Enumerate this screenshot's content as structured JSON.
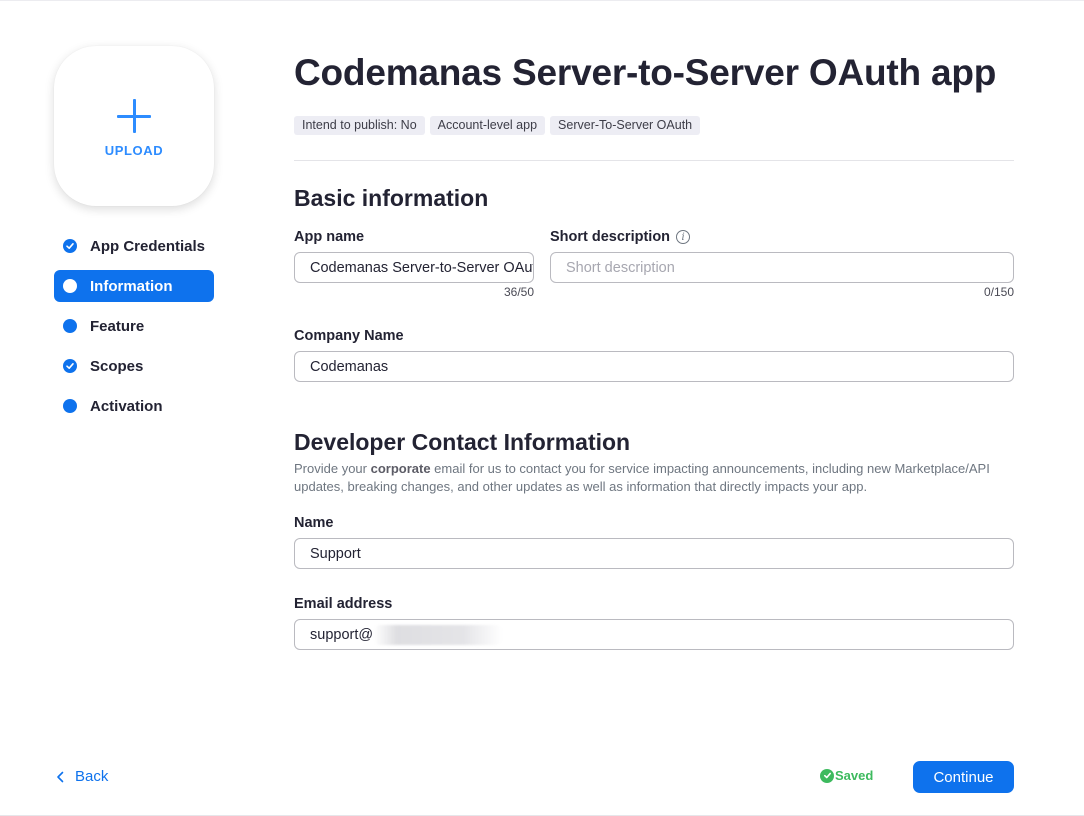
{
  "upload": {
    "label": "UPLOAD",
    "icon": "plus-icon"
  },
  "steps": [
    {
      "label": "App Credentials",
      "state": "done",
      "icon": "check-circle-icon"
    },
    {
      "label": "Information",
      "state": "active",
      "icon": "dot-icon"
    },
    {
      "label": "Feature",
      "state": "pending",
      "icon": "dot-icon"
    },
    {
      "label": "Scopes",
      "state": "done",
      "icon": "check-circle-icon"
    },
    {
      "label": "Activation",
      "state": "pending",
      "icon": "dot-icon"
    }
  ],
  "header": {
    "title": "Codemanas Server-to-Server OAuth app",
    "badges": [
      "Intend to publish: No",
      "Account-level app",
      "Server-To-Server OAuth"
    ]
  },
  "basic_info": {
    "title": "Basic information",
    "app_name": {
      "label": "App name",
      "value": "Codemanas Server-to-Server OAuth app",
      "counter": "36/50"
    },
    "short_description": {
      "label": "Short description",
      "placeholder": "Short description",
      "value": "",
      "counter": "0/150",
      "icon": "info-icon"
    },
    "company_name": {
      "label": "Company Name",
      "value": "Codemanas"
    }
  },
  "developer_contact": {
    "title": "Developer Contact Information",
    "description_before": "Provide your ",
    "description_bold": "corporate",
    "description_after": " email for us to contact you for service impacting announcements, including new Marketplace/API updates, breaking changes, and other updates as well as information that directly impacts your app.",
    "name": {
      "label": "Name",
      "value": "Support"
    },
    "email": {
      "label": "Email address",
      "value": "support@"
    }
  },
  "footer": {
    "back_label": "Back",
    "saved_label": "Saved",
    "continue_label": "Continue"
  },
  "colors": {
    "accent": "#0e72ed",
    "upload_accent": "#2d8cff",
    "saved": "#3dba5e"
  }
}
